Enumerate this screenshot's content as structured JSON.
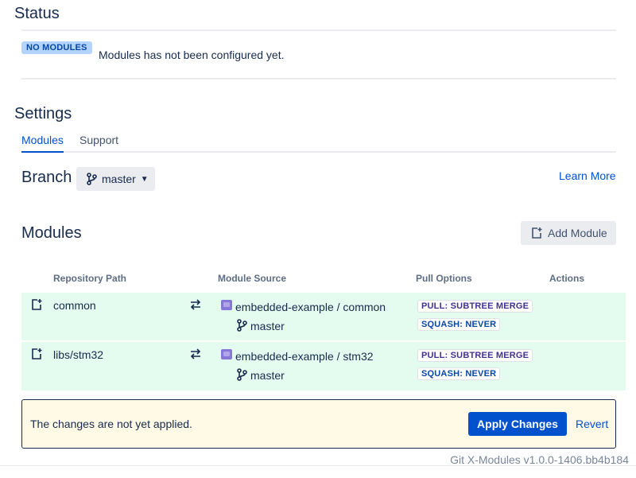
{
  "status": {
    "heading": "Status",
    "badge": "NO MODULES",
    "message": "Modules has not been configured yet."
  },
  "settings": {
    "heading": "Settings",
    "tabs": [
      {
        "label": "Modules",
        "active": true
      },
      {
        "label": "Support",
        "active": false
      }
    ]
  },
  "branch": {
    "heading": "Branch",
    "selected": "master",
    "learn_more": "Learn More"
  },
  "modules": {
    "heading": "Modules",
    "add_button": "Add Module",
    "columns": [
      "Repository Path",
      "Module Source",
      "Pull Options",
      "Actions"
    ],
    "rows": [
      {
        "path": "common",
        "source": "embedded-example / common",
        "branch": "master",
        "pull_option": "PULL: SUBTREE MERGE",
        "squash_option": "SQUASH: NEVER"
      },
      {
        "path": "libs/stm32",
        "source": "embedded-example / stm32",
        "branch": "master",
        "pull_option": "PULL: SUBTREE MERGE",
        "squash_option": "SQUASH: NEVER"
      }
    ]
  },
  "notice": {
    "message": "The changes are not yet applied.",
    "apply": "Apply Changes",
    "revert": "Revert"
  },
  "footer": {
    "version": "Git X-Modules v1.0.0-1406.bb4b184"
  },
  "colors": {
    "primary": "#0052cc",
    "row_bg": "#e3fcef",
    "notice_bg": "#fffae6",
    "badge_bg": "#b3d4ff",
    "folder": "#8777d9"
  }
}
